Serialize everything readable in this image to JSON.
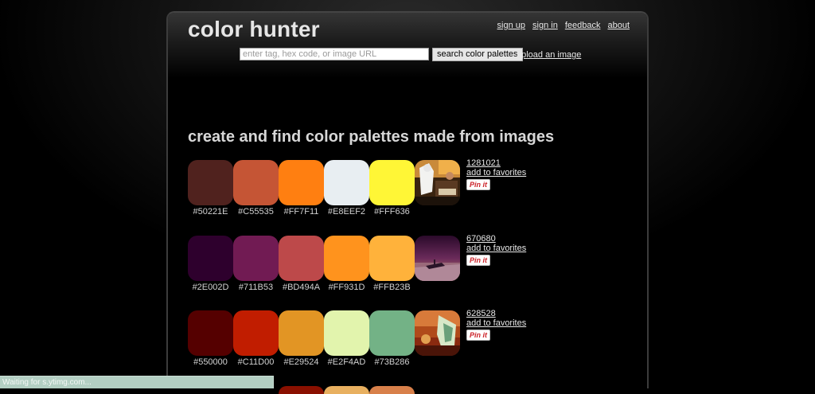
{
  "header": {
    "logo": "color hunter",
    "links": [
      "sign up",
      "sign in",
      "feedback",
      "about"
    ],
    "search": {
      "placeholder": "enter tag, hex code, or image URL",
      "value": "",
      "button_label": "search color palettes",
      "upload_link": "upload an image"
    }
  },
  "main": {
    "tagline": "create and find color palettes made from images",
    "palettes": [
      {
        "id": "1281021",
        "favorite_label": "add to favorites",
        "pin_label": "Pin it",
        "colors": [
          "#50221E",
          "#C55535",
          "#FF7F11",
          "#E8EEF2",
          "#FFF636"
        ]
      },
      {
        "id": "670680",
        "favorite_label": "add to favorites",
        "pin_label": "Pin it",
        "colors": [
          "#2E002D",
          "#711B53",
          "#BD494A",
          "#FF931D",
          "#FFB23B"
        ]
      },
      {
        "id": "628528",
        "favorite_label": "add to favorites",
        "pin_label": "Pin it",
        "colors": [
          "#550000",
          "#C11D00",
          "#E29524",
          "#E2F4AD",
          "#73B286"
        ]
      }
    ]
  },
  "status_bar": {
    "text": "Waiting for s.ytimg.com..."
  }
}
